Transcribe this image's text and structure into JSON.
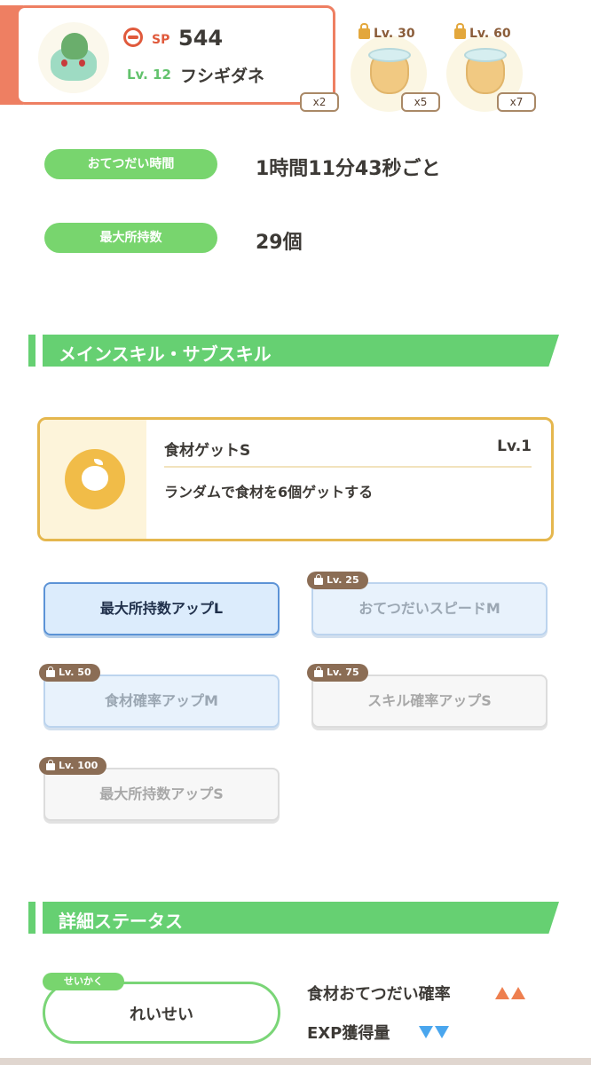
{
  "pokemon": {
    "sp_label": "SP",
    "sp_value": "544",
    "level": "Lv. 12",
    "name": "フシギダネ"
  },
  "ingredient_slots": [
    {
      "multiplier": "x2"
    },
    {
      "lock_level": "Lv. 30",
      "multiplier": "x5"
    },
    {
      "lock_level": "Lv. 60",
      "multiplier": "x7"
    }
  ],
  "stats": {
    "help_time_label": "おてつだい時間",
    "help_time_value": "1時間11分43秒ごと",
    "max_carry_label": "最大所持数",
    "max_carry_value": "29個"
  },
  "skills_section": {
    "title": "メインスキル・サブスキル",
    "main_skill": {
      "name": "食材ゲットS",
      "level": "Lv.1",
      "description": "ランダムで食材を6個ゲットする"
    },
    "sub_skills": [
      {
        "label": "最大所持数アップL",
        "unlock": "",
        "state": "unlocked"
      },
      {
        "label": "おてつだいスピードM",
        "unlock": "Lv. 25",
        "state": "locked"
      },
      {
        "label": "食材確率アップM",
        "unlock": "Lv. 50",
        "state": "locked"
      },
      {
        "label": "スキル確率アップS",
        "unlock": "Lv. 75",
        "state": "locked"
      },
      {
        "label": "最大所持数アップS",
        "unlock": "Lv. 100",
        "state": "locked"
      }
    ]
  },
  "details_section": {
    "title": "詳細ステータス",
    "nature_tag": "せいかく",
    "nature_value": "れいせい",
    "effects": [
      {
        "label": "食材おてつだい確率",
        "direction": "up",
        "color": "#ee7f4f"
      },
      {
        "label": "EXP獲得量",
        "direction": "down",
        "color": "#4aa6ee"
      }
    ]
  },
  "colors": {
    "accent_green": "#66d072",
    "card_border_red": "#ee7f62",
    "skill_gold": "#e5b74e",
    "active_blue": "#5c93d6"
  }
}
